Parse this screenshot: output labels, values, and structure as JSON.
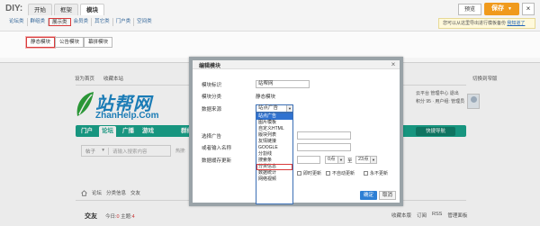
{
  "diy": {
    "logo": "DIY:",
    "tabs": [
      {
        "label": "开始"
      },
      {
        "label": "框架"
      },
      {
        "label": "模块"
      }
    ],
    "preview_label": "预览",
    "save_label": "保存",
    "close_glyph": "×",
    "subtabs": [
      {
        "label": "论坛类"
      },
      {
        "label": "群组类"
      },
      {
        "label": "展示类"
      },
      {
        "label": "会员类"
      },
      {
        "label": "其它类"
      },
      {
        "label": "门户类"
      },
      {
        "label": "空间类"
      }
    ],
    "notice_text": "您可以从这里导出进行模板备份",
    "notice_link": "我知道了",
    "modules": [
      {
        "label": "静态模块"
      },
      {
        "label": "公告模块"
      },
      {
        "label": "幕拼模块"
      }
    ]
  },
  "site": {
    "topbar_left": [
      "设为首页",
      "收藏本站"
    ],
    "topbar_right": [
      "切换到窄版"
    ],
    "logo_cn": "站帮网",
    "logo_en": "ZhanHelp.Com",
    "user_lines": [
      "云平台  管理中心  退出",
      "积分 95 ·  用户组: 管理员"
    ],
    "nav": [
      "门户",
      "论坛",
      "广播",
      "游戏",
      "群组"
    ],
    "quicknav_label": "快捷导航",
    "search_type": "帖子",
    "search_placeholder": "请输入搜索内容",
    "hot_keywords": "热搜:",
    "breadcrumb": [
      "论坛",
      "分类信息",
      "交友"
    ],
    "forum_title": "交友",
    "forum_stats": {
      "today_label": "今日:",
      "today": "0",
      "topics_label": "主题:",
      "topics": "4"
    },
    "forum_actions": [
      "收藏本版",
      "订阅",
      "RSS",
      "管理面板"
    ]
  },
  "dialog": {
    "title": "编辑模块",
    "close_glyph": "×",
    "fields": {
      "module_id_label": "模块标识",
      "module_id_value": "站帮网",
      "module_class_label": "模块分类",
      "module_class_value": "静态模块",
      "data_source_label": "数据来源",
      "data_source_value": "站点广告",
      "ad_label": "选择广告",
      "custom_name_label": "或者输入名称",
      "update_label": "数据缓存更新"
    },
    "source_options": [
      "站点广告",
      "图片模板",
      "自定义HTML",
      "版块列表",
      "友情链接",
      "GOOGLE",
      "分割线",
      "搜索条",
      "分类信息",
      "数据统计",
      "网络视频"
    ],
    "selected_option_index": 0,
    "highlight_option_index": 8,
    "time_start": "0点",
    "time_end": "23点",
    "cache_to": "至",
    "checkbox_labels": [
      "即时更新",
      "不自动更新",
      "永不更新"
    ],
    "ok_label": "确定",
    "cancel_label": "取消"
  }
}
